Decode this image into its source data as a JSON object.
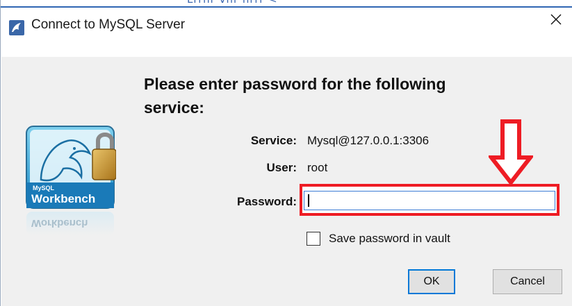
{
  "window": {
    "title": "Connect to MySQL Server",
    "app_icon": "mysql-workbench-icon",
    "close_icon": "close-icon"
  },
  "background_text": "Lrrnr vhr nrrr <",
  "dialog": {
    "heading": "Please enter password for the following service:",
    "logo_text_small": "MySQL",
    "logo_text": "Workbench",
    "logo_reflection_text": "Workbench",
    "service_label": "Service:",
    "service_value": "Mysql@127.0.0.1:3306",
    "user_label": "User:",
    "user_value": "root",
    "password_label": "Password:",
    "password_value": "",
    "save_vault_label": "Save password in vault",
    "save_vault_checked": false,
    "ok_label": "OK",
    "cancel_label": "Cancel"
  },
  "annotations": {
    "highlight_color": "#ee1c24",
    "arrow_icon": "down-arrow-outline-icon"
  },
  "colors": {
    "titlebar_bg": "#ffffff",
    "client_bg": "#f0f0f0",
    "accent": "#0078d7"
  }
}
